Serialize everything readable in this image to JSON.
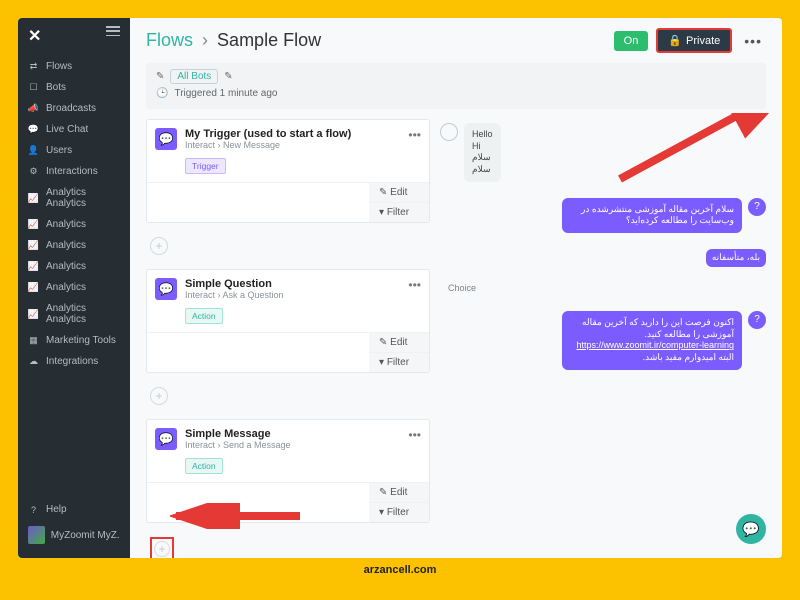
{
  "sidebar": {
    "items": [
      {
        "icon": "⇄",
        "label": "Flows"
      },
      {
        "icon": "☐",
        "label": "Bots"
      },
      {
        "icon": "📣",
        "label": "Broadcasts"
      },
      {
        "icon": "💬",
        "label": "Live Chat"
      },
      {
        "icon": "👤",
        "label": "Users"
      },
      {
        "icon": "⚙",
        "label": "Interactions"
      },
      {
        "icon": "📈",
        "label": "Analytics",
        "label2": "Analytics"
      },
      {
        "icon": "📈",
        "label": "Analytics"
      },
      {
        "icon": "📈",
        "label": "Analytics"
      },
      {
        "icon": "📈",
        "label": "Analytics"
      },
      {
        "icon": "📈",
        "label": "Analytics"
      },
      {
        "icon": "📈",
        "label": "Analytics",
        "label2": "Analytics"
      },
      {
        "icon": "▦",
        "label": "Marketing Tools"
      },
      {
        "icon": "☁",
        "label": "Integrations"
      }
    ],
    "help_label": "Help",
    "workspace": "MyZoomit MyZ..."
  },
  "header": {
    "flows_label": "Flows",
    "separator": "›",
    "flow_name": "Sample Flow",
    "on_label": "On",
    "private_label": "Private"
  },
  "infobar": {
    "all_bots": "All Bots",
    "triggered": "Triggered 1 minute ago"
  },
  "nodes": [
    {
      "title": "My Trigger (used to start a flow)",
      "sub": "Interact › New Message",
      "tag": "Trigger",
      "tag_type": "trigger",
      "edit": "Edit",
      "filter": "Filter"
    },
    {
      "title": "Simple Question",
      "sub": "Interact › Ask a Question",
      "tag": "Action",
      "tag_type": "action",
      "edit": "Edit",
      "filter": "Filter"
    },
    {
      "title": "Simple Message",
      "sub": "Interact › Send a Message",
      "tag": "Action",
      "tag_type": "action",
      "edit": "Edit",
      "filter": "Filter"
    }
  ],
  "preview": {
    "greeting": [
      "Hello",
      "Hi",
      "سلام",
      "سلام"
    ],
    "question": "سلام آخرین مقاله آموزشی منتشرشده در وب‌سایت را مطالعه کرده‌اید؟",
    "answer": "بله، متأسفانه",
    "choice_label": "Choice",
    "message_text": "اکنون فرصت این را دارید که آخرین مقاله آموزشی را مطالعه کنید.",
    "message_link": "https://www.zoomit.ir/computer-learning",
    "message_tail": "البته امیدوارم مفید باشد."
  },
  "footer": "arzancell.com"
}
